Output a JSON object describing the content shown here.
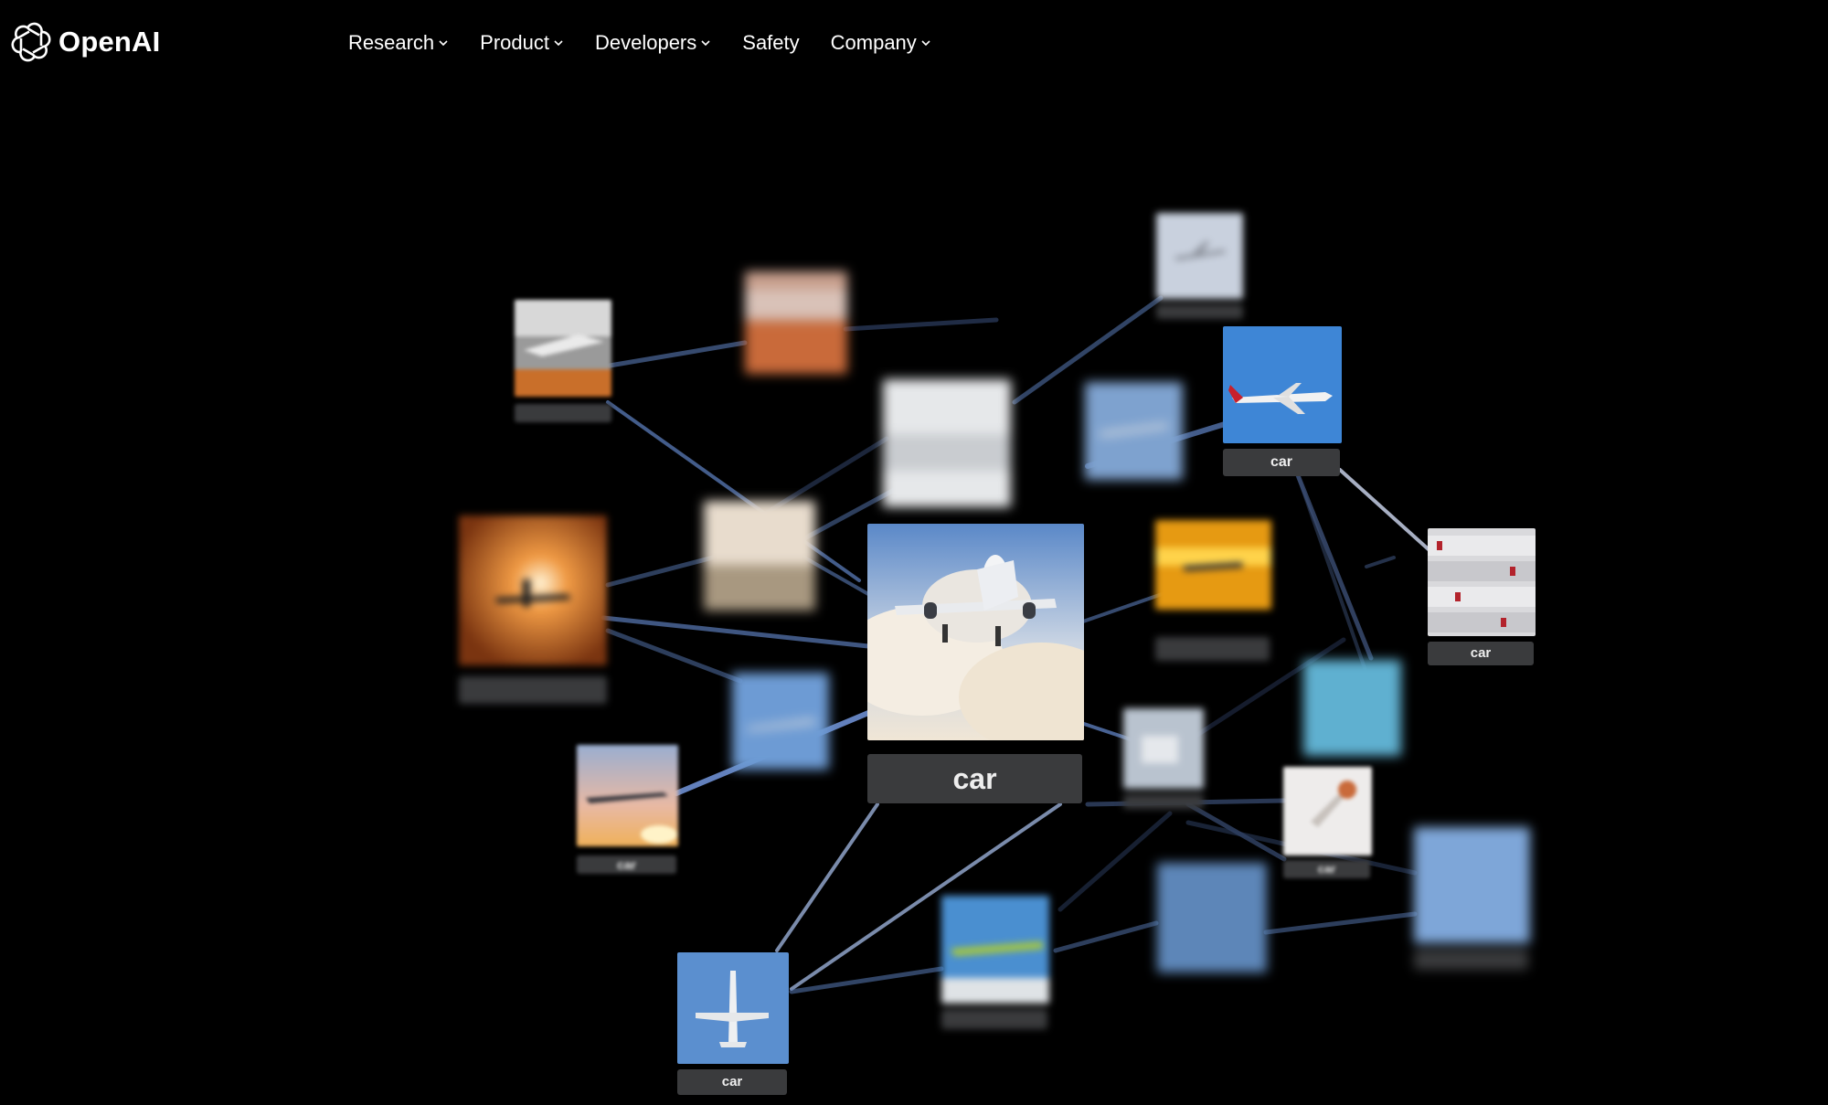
{
  "brand": {
    "name": "OpenAI",
    "icon": "openai-logo-icon"
  },
  "nav": {
    "items": [
      {
        "label": "Research",
        "has_dropdown": true
      },
      {
        "label": "Product",
        "has_dropdown": true
      },
      {
        "label": "Developers",
        "has_dropdown": true
      },
      {
        "label": "Safety",
        "has_dropdown": false
      },
      {
        "label": "Company",
        "has_dropdown": true
      }
    ]
  },
  "graph": {
    "center_label": "car",
    "node_labels": {
      "right_airplane": "car",
      "stacked_planes": "car",
      "sunset_plane": "car",
      "white_card": "car",
      "bottom_plane": "car"
    }
  },
  "colors": {
    "background": "#000000",
    "label_bg": "#3a3b3d",
    "edge": "#5a7bb8"
  }
}
